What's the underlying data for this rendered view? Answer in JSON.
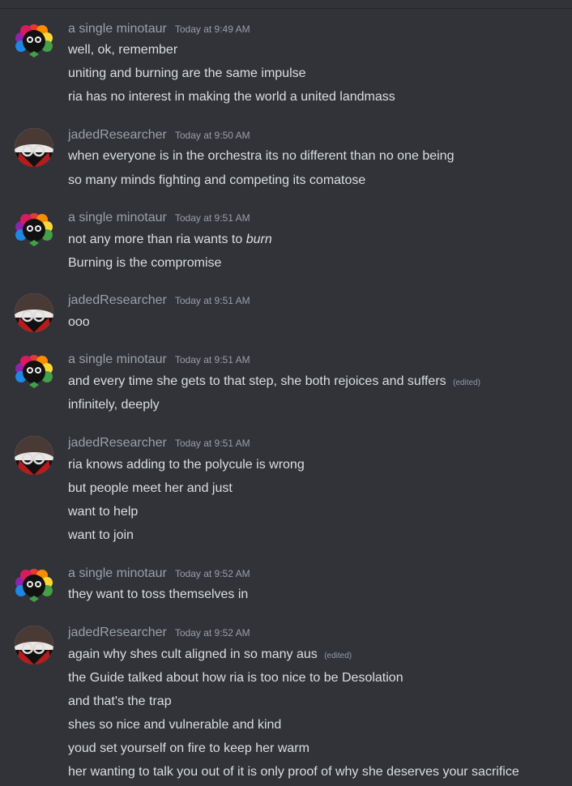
{
  "messages": [
    {
      "author": "a single minotaur",
      "time": "Today at 9:49 AM",
      "avatar": "rainbow-clown-avatar",
      "lines": [
        "well, ok, remember",
        "uniting and burning are the same impulse",
        "ria has no interest in making the world a united landmass"
      ]
    },
    {
      "author": "jadedResearcher",
      "time": "Today at 9:50 AM",
      "avatar": "dark-glasses-avatar",
      "lines": [
        "when everyone is in the orchestra its no different than no one being",
        "so many minds fighting and competing its comatose"
      ]
    },
    {
      "author": "a single minotaur",
      "time": "Today at 9:51 AM",
      "avatar": "rainbow-clown-avatar",
      "lines": [
        "not any more than ria wants to",
        "Burning is the compromise"
      ],
      "italic_word": "burn"
    },
    {
      "author": "jadedResearcher",
      "time": "Today at 9:51 AM",
      "avatar": "dark-glasses-avatar",
      "lines": [
        "ooo"
      ]
    },
    {
      "author": "a single minotaur",
      "time": "Today at 9:51 AM",
      "avatar": "rainbow-clown-avatar",
      "lines": [
        "and every time she gets to that step, she both rejoices and suffers",
        "infinitely, deeply"
      ],
      "edited_label": "(edited)"
    },
    {
      "author": "jadedResearcher",
      "time": "Today at 9:51 AM",
      "avatar": "dark-glasses-avatar",
      "lines": [
        "ria knows adding to the polycule is wrong",
        "but people meet her and just",
        "want to help",
        "want to join"
      ]
    },
    {
      "author": "a single minotaur",
      "time": "Today at 9:52 AM",
      "avatar": "rainbow-clown-avatar",
      "lines": [
        "they want to toss themselves in"
      ]
    },
    {
      "author": "jadedResearcher",
      "time": "Today at 9:52 AM",
      "avatar": "dark-glasses-avatar",
      "lines": [
        "again why shes cult aligned in so many aus",
        "the Guide talked about how ria is too nice to be Desolation",
        "and that's the trap",
        "shes so nice and vulnerable and kind",
        "youd set yourself on fire to keep her warm",
        "her wanting to talk you out of it is only proof of why she deserves your sacrifice"
      ],
      "edited_label": "(edited)"
    }
  ],
  "colors": {
    "background": "#313338",
    "text": "#dbdee1",
    "author": "#9aa0a6",
    "timestamp": "#9b9ea6"
  }
}
